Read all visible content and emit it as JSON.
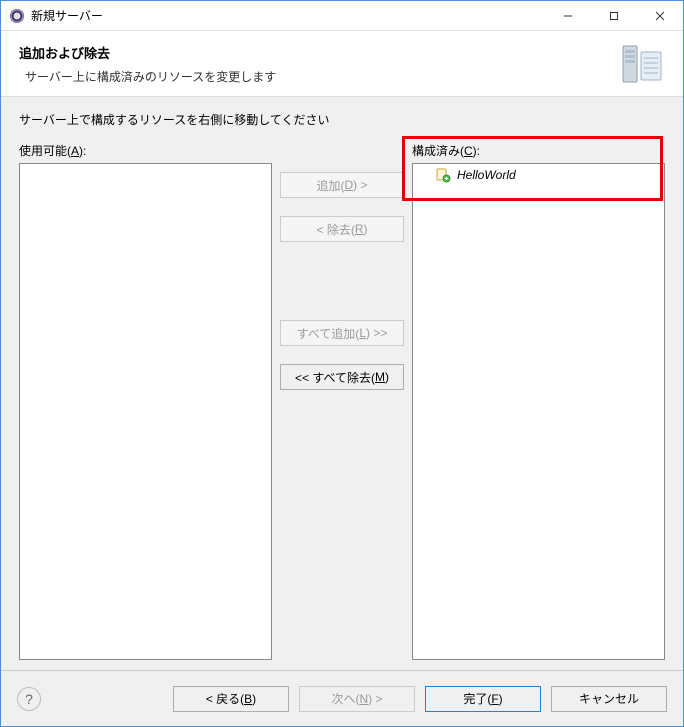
{
  "titlebar": {
    "title": "新規サーバー"
  },
  "banner": {
    "title": "追加および除去",
    "subtitle": "サーバー上に構成済みのリソースを変更します"
  },
  "content": {
    "instruction": "サーバー上で構成するリソースを右側に移動してください",
    "available": {
      "label_prefix": "使用可能(",
      "label_key": "A",
      "label_suffix": "):",
      "items": []
    },
    "configured": {
      "label_prefix": "構成済み(",
      "label_key": "C",
      "label_suffix": "):",
      "items": [
        {
          "name": "HelloWorld"
        }
      ]
    },
    "buttons": {
      "add_prefix": "追加(",
      "add_key": "D",
      "add_suffix": ") >",
      "remove_prefix": "< 除去(",
      "remove_key": "R",
      "remove_suffix": ")",
      "addall_prefix": "すべて追加(",
      "addall_key": "L",
      "addall_suffix": ") >>",
      "removeall_prefix": "<< すべて除去(",
      "removeall_key": "M",
      "removeall_suffix": ")"
    }
  },
  "footer": {
    "help": "?",
    "back_prefix": "< 戻る(",
    "back_key": "B",
    "back_suffix": ")",
    "next_prefix": "次へ(",
    "next_key": "N",
    "next_suffix": ") >",
    "finish_prefix": "完了(",
    "finish_key": "F",
    "finish_suffix": ")",
    "cancel": "キャンセル"
  }
}
